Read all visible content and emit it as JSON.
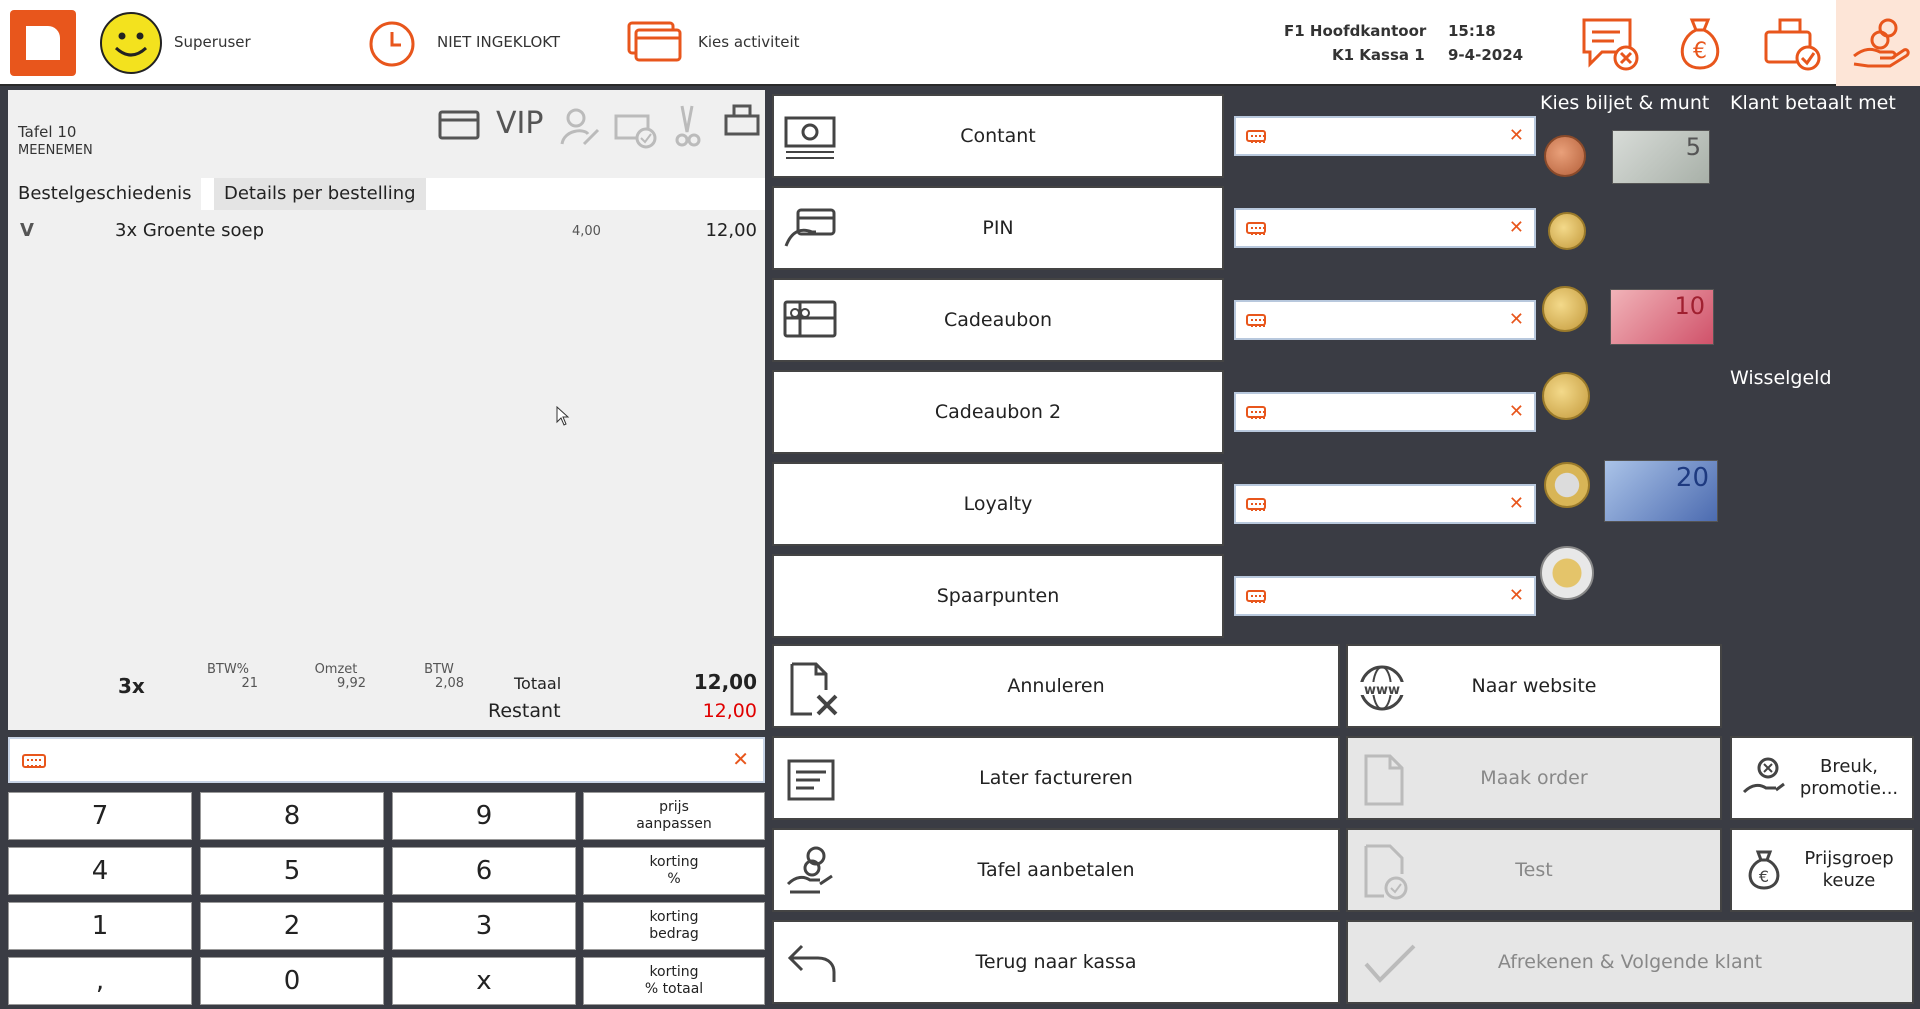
{
  "header": {
    "user": "Superuser",
    "clock_status": "NIET INGEKLOKT",
    "activity": "Kies activiteit",
    "location_line1": "F1 Hoofdkantoor",
    "location_line2": "K1 Kassa 1",
    "time": "15:18",
    "date": "9-4-2024"
  },
  "order": {
    "table": "Tafel 10",
    "subtitle": "MEENEMEN",
    "vip_label": "VIP",
    "tabs": [
      "Bestelgeschiedenis",
      "Details per bestelling"
    ],
    "items": [
      {
        "flag": "V",
        "description": "3x Groente soep",
        "unit_price": "4,00",
        "total": "12,00"
      }
    ],
    "summary": {
      "count": "3x",
      "btw_pct_label": "BTW%",
      "btw_pct": "21",
      "omzet_label": "Omzet",
      "omzet": "9,92",
      "btw_label": "BTW",
      "btw": "2,08",
      "totaal_label": "Totaal",
      "totaal": "12,00",
      "restant_label": "Restant",
      "restant": "12,00"
    }
  },
  "keypad": {
    "keys": [
      "7",
      "8",
      "9",
      "4",
      "5",
      "6",
      "1",
      "2",
      "3",
      ",",
      "0",
      "x"
    ],
    "functions": [
      [
        "prijs",
        "aanpassen"
      ],
      [
        "korting",
        "%"
      ],
      [
        "korting",
        "bedrag"
      ],
      [
        "korting",
        "% totaal"
      ]
    ]
  },
  "payment_methods": [
    "Contant",
    "PIN",
    "Cadeaubon",
    "Cadeaubon 2",
    "Loyalty",
    "Spaarpunten"
  ],
  "payment_side": {
    "choose_label": "Kies biljet & munt",
    "customer_pays_label": "Klant betaalt met",
    "change_label": "Wisselgeld",
    "notes": [
      "5",
      "10",
      "20"
    ]
  },
  "actions": {
    "cancel": "Annuleren",
    "website": "Naar website",
    "invoice_later": "Later factureren",
    "make_order": "Maak order",
    "fraction": [
      "Breuk,",
      "promotie..."
    ],
    "table_prepay": "Tafel aanbetalen",
    "test": "Test",
    "price_group": [
      "Prijsgroep",
      "keuze"
    ],
    "back": "Terug naar kassa",
    "checkout_next": "Afrekenen & Volgende klant"
  },
  "colors": {
    "accent": "#e8561c",
    "panel_bg": "#3a3c44",
    "restant_red": "#e00000"
  }
}
